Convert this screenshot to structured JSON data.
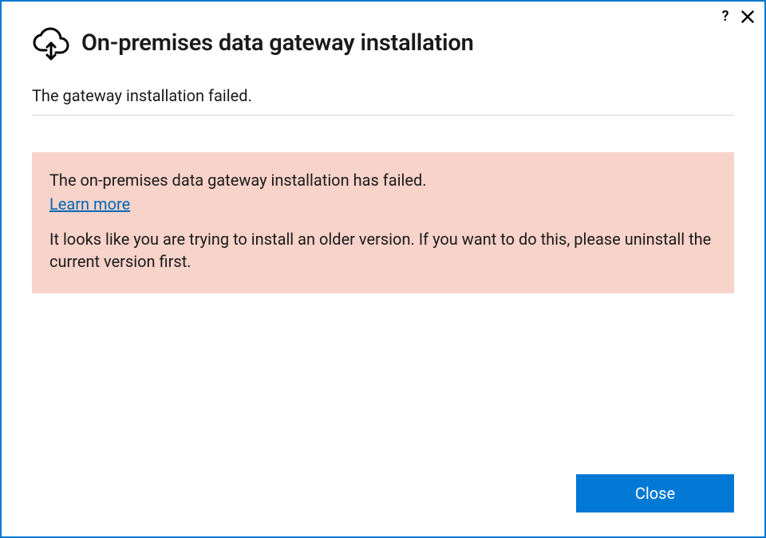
{
  "titlebar": {
    "help_glyph": "?"
  },
  "header": {
    "title": "On-premises data gateway installation"
  },
  "status": {
    "message": "The gateway installation failed."
  },
  "error": {
    "primary": "The on-premises data gateway installation has failed.",
    "link_label": "Learn more",
    "detail": "It looks like you are trying to install an older version. If you want to do this, please uninstall the current version first."
  },
  "footer": {
    "close_label": "Close"
  }
}
